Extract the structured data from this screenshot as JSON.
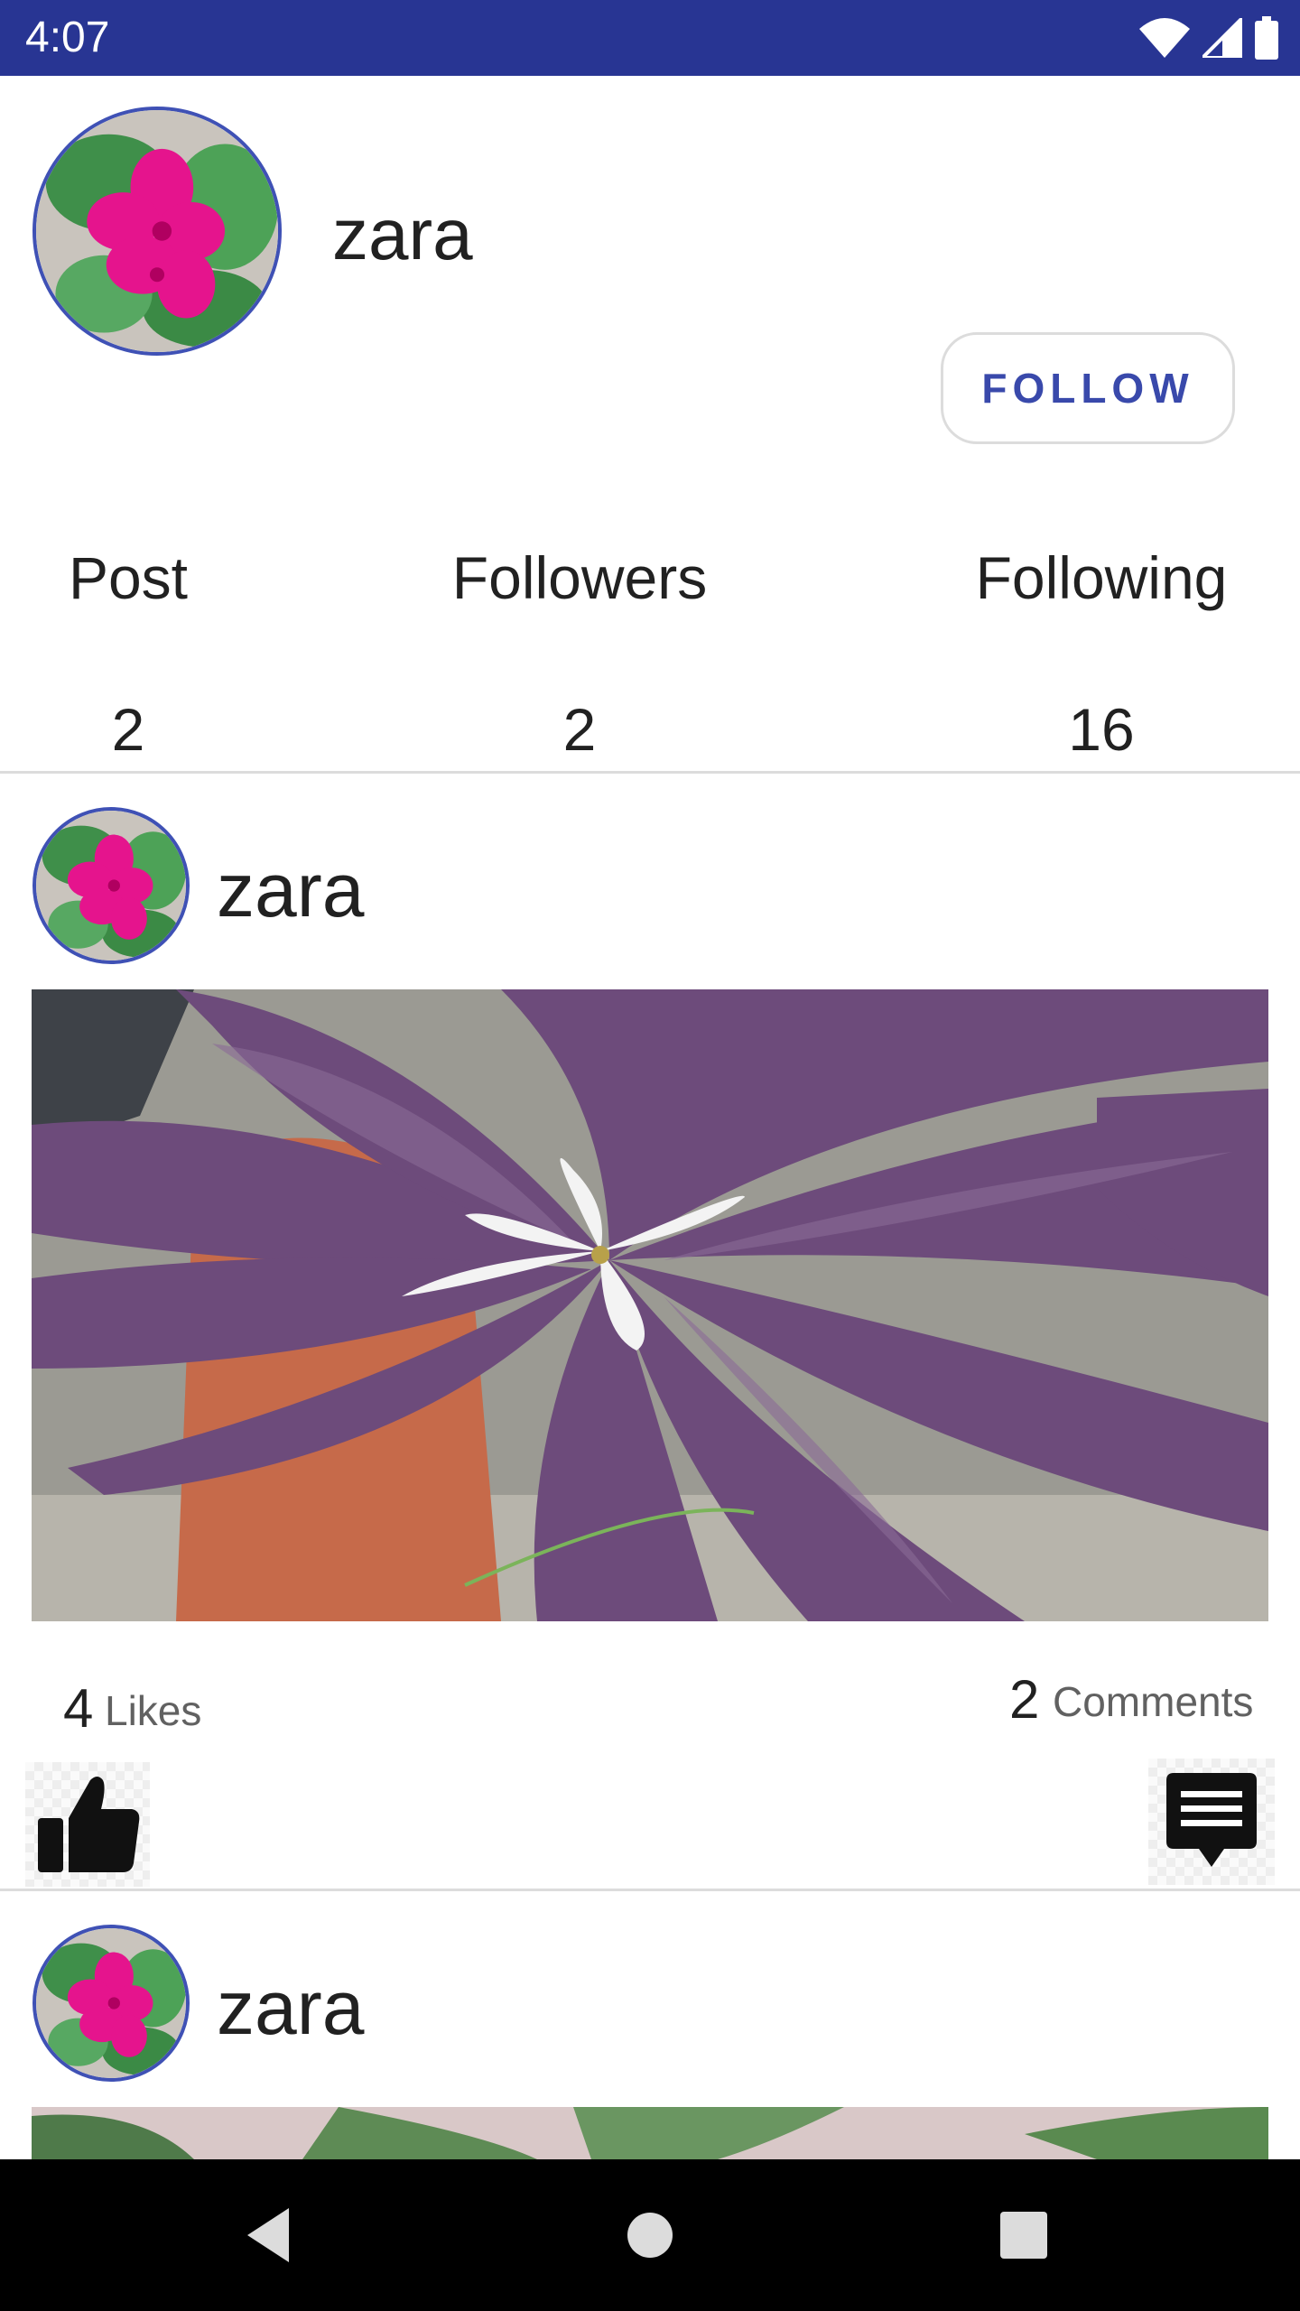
{
  "status_bar": {
    "time": "4:07",
    "icons": [
      "wifi-icon",
      "cell-signal-icon",
      "battery-icon"
    ],
    "background": "#283593"
  },
  "profile": {
    "username": "zara",
    "follow_label": "FOLLOW",
    "stats": [
      {
        "label": "Post",
        "value": "2"
      },
      {
        "label": "Followers",
        "value": "2"
      },
      {
        "label": "Following",
        "value": "16"
      }
    ]
  },
  "posts": [
    {
      "username": "zara",
      "likes_count": "4",
      "likes_label": "Likes",
      "comments_count": "2",
      "comments_label": "Comments"
    },
    {
      "username": "zara"
    }
  ],
  "icons": {
    "like": "thumbs-up-icon",
    "comment": "comment-icon"
  },
  "nav_bar": {
    "buttons": [
      "back-icon",
      "home-icon",
      "recents-icon"
    ]
  },
  "colors": {
    "accent": "#3949ab",
    "avatar_border": "#3f51b5",
    "divider": "#dcdcdc"
  }
}
